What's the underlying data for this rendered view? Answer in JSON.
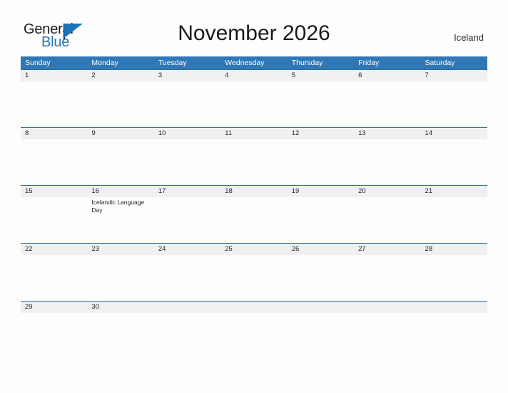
{
  "brand": {
    "name_part1": "General",
    "name_part2": "Blue",
    "triangle_icon": "triangle-logo-icon",
    "accent_color": "#1b73b8"
  },
  "header": {
    "title": "November 2026",
    "region": "Iceland"
  },
  "colors": {
    "header_blue": "#3077b5",
    "row_divider_blue": "#2f6ea8",
    "date_band_gray": "#f0f0f0",
    "page_background": "#fdfdfd"
  },
  "calendar": {
    "weekdays": [
      "Sunday",
      "Monday",
      "Tuesday",
      "Wednesday",
      "Thursday",
      "Friday",
      "Saturday"
    ],
    "weeks": [
      {
        "days": [
          {
            "number": "1",
            "events": []
          },
          {
            "number": "2",
            "events": []
          },
          {
            "number": "3",
            "events": []
          },
          {
            "number": "4",
            "events": []
          },
          {
            "number": "5",
            "events": []
          },
          {
            "number": "6",
            "events": []
          },
          {
            "number": "7",
            "events": []
          }
        ]
      },
      {
        "days": [
          {
            "number": "8",
            "events": []
          },
          {
            "number": "9",
            "events": []
          },
          {
            "number": "10",
            "events": []
          },
          {
            "number": "11",
            "events": []
          },
          {
            "number": "12",
            "events": []
          },
          {
            "number": "13",
            "events": []
          },
          {
            "number": "14",
            "events": []
          }
        ]
      },
      {
        "days": [
          {
            "number": "15",
            "events": []
          },
          {
            "number": "16",
            "events": [
              "Icelandic Language Day"
            ]
          },
          {
            "number": "17",
            "events": []
          },
          {
            "number": "18",
            "events": []
          },
          {
            "number": "19",
            "events": []
          },
          {
            "number": "20",
            "events": []
          },
          {
            "number": "21",
            "events": []
          }
        ]
      },
      {
        "days": [
          {
            "number": "22",
            "events": []
          },
          {
            "number": "23",
            "events": []
          },
          {
            "number": "24",
            "events": []
          },
          {
            "number": "25",
            "events": []
          },
          {
            "number": "26",
            "events": []
          },
          {
            "number": "27",
            "events": []
          },
          {
            "number": "28",
            "events": []
          }
        ]
      },
      {
        "days": [
          {
            "number": "29",
            "events": []
          },
          {
            "number": "30",
            "events": []
          },
          {
            "number": "",
            "events": []
          },
          {
            "number": "",
            "events": []
          },
          {
            "number": "",
            "events": []
          },
          {
            "number": "",
            "events": []
          },
          {
            "number": "",
            "events": []
          }
        ]
      }
    ]
  }
}
